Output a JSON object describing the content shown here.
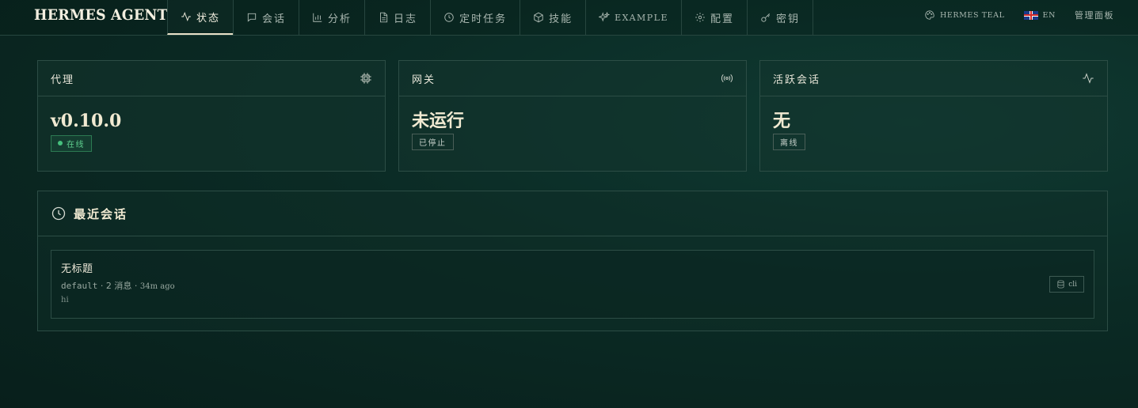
{
  "brand": "HERMES AGENT",
  "nav": [
    {
      "label": "状态",
      "icon": "activity-icon",
      "active": true
    },
    {
      "label": "会话",
      "icon": "chat-icon"
    },
    {
      "label": "分析",
      "icon": "bar-chart-icon"
    },
    {
      "label": "日志",
      "icon": "document-icon"
    },
    {
      "label": "定时任务",
      "icon": "clock-icon"
    },
    {
      "label": "技能",
      "icon": "package-icon"
    },
    {
      "label": "EXAMPLE",
      "icon": "sparkles-icon"
    },
    {
      "label": "配置",
      "icon": "gear-icon"
    },
    {
      "label": "密钥",
      "icon": "key-icon"
    }
  ],
  "tools": {
    "theme": "HERMES TEAL",
    "language": "EN",
    "admin": "管理面板"
  },
  "cards": [
    {
      "title": "代理",
      "icon": "cpu-icon",
      "value": "v0.10.0",
      "status": "在线"
    },
    {
      "title": "网关",
      "icon": "radio-signal-icon",
      "value": "未运行",
      "status": "已停止"
    },
    {
      "title": "活跃会话",
      "icon": "activity-icon",
      "value": "无",
      "status": "离线"
    }
  ],
  "recent": {
    "title": "最近会话",
    "sessions": [
      {
        "title": "无标题",
        "profile": "default",
        "messages": "· 2 消息 ·",
        "time": "34m ago",
        "snippet": "hi",
        "source": "cli"
      }
    ]
  },
  "colors": {
    "background": "#0b2b25",
    "border": "#2c4d45",
    "accent_text": "#f1ead2",
    "online_green": "#5fd08f"
  }
}
